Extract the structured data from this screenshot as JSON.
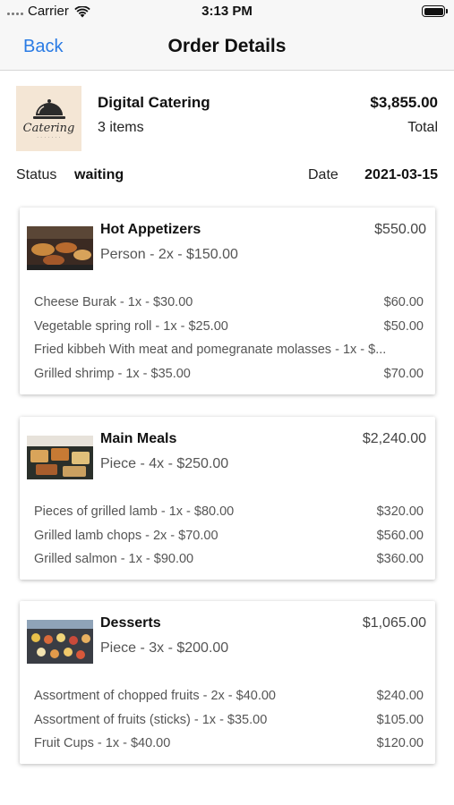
{
  "status_bar": {
    "carrier": "Carrier",
    "time": "3:13 PM"
  },
  "nav": {
    "back_label": "Back",
    "title": "Order Details"
  },
  "order": {
    "vendor_name": "Digital Catering",
    "logo_text": "Catering",
    "item_count": "3 items",
    "total": "$3,855.00",
    "total_label": "Total",
    "status_label": "Status",
    "status_value": "waiting",
    "date_label": "Date",
    "date_value": "2021-03-15"
  },
  "items": [
    {
      "name": "Hot Appetizers",
      "price": "$550.00",
      "unit_info": "Person - 2x - $150.00",
      "sub_items": [
        {
          "name": "Cheese Burak - 1x - $30.00",
          "price": "$60.00"
        },
        {
          "name": "Vegetable spring roll - 1x - $25.00",
          "price": "$50.00"
        },
        {
          "name": "Fried kibbeh With meat and pomegranate molasses - 1x - $...",
          "price": ""
        },
        {
          "name": "Grilled shrimp - 1x - $35.00",
          "price": "$70.00"
        }
      ]
    },
    {
      "name": "Main Meals",
      "price": "$2,240.00",
      "unit_info": "Piece - 4x - $250.00",
      "sub_items": [
        {
          "name": "Pieces of grilled lamb - 1x - $80.00",
          "price": "$320.00"
        },
        {
          "name": "Grilled lamb chops - 2x - $70.00",
          "price": "$560.00"
        },
        {
          "name": "Grilled salmon - 1x - $90.00",
          "price": "$360.00"
        }
      ]
    },
    {
      "name": "Desserts",
      "price": "$1,065.00",
      "unit_info": "Piece - 3x - $200.00",
      "sub_items": [
        {
          "name": "Assortment of chopped fruits - 2x - $40.00",
          "price": "$240.00"
        },
        {
          "name": "Assortment of fruits (sticks) - 1x - $35.00",
          "price": "$105.00"
        },
        {
          "name": "Fruit Cups - 1x - $40.00",
          "price": "$120.00"
        }
      ]
    }
  ]
}
